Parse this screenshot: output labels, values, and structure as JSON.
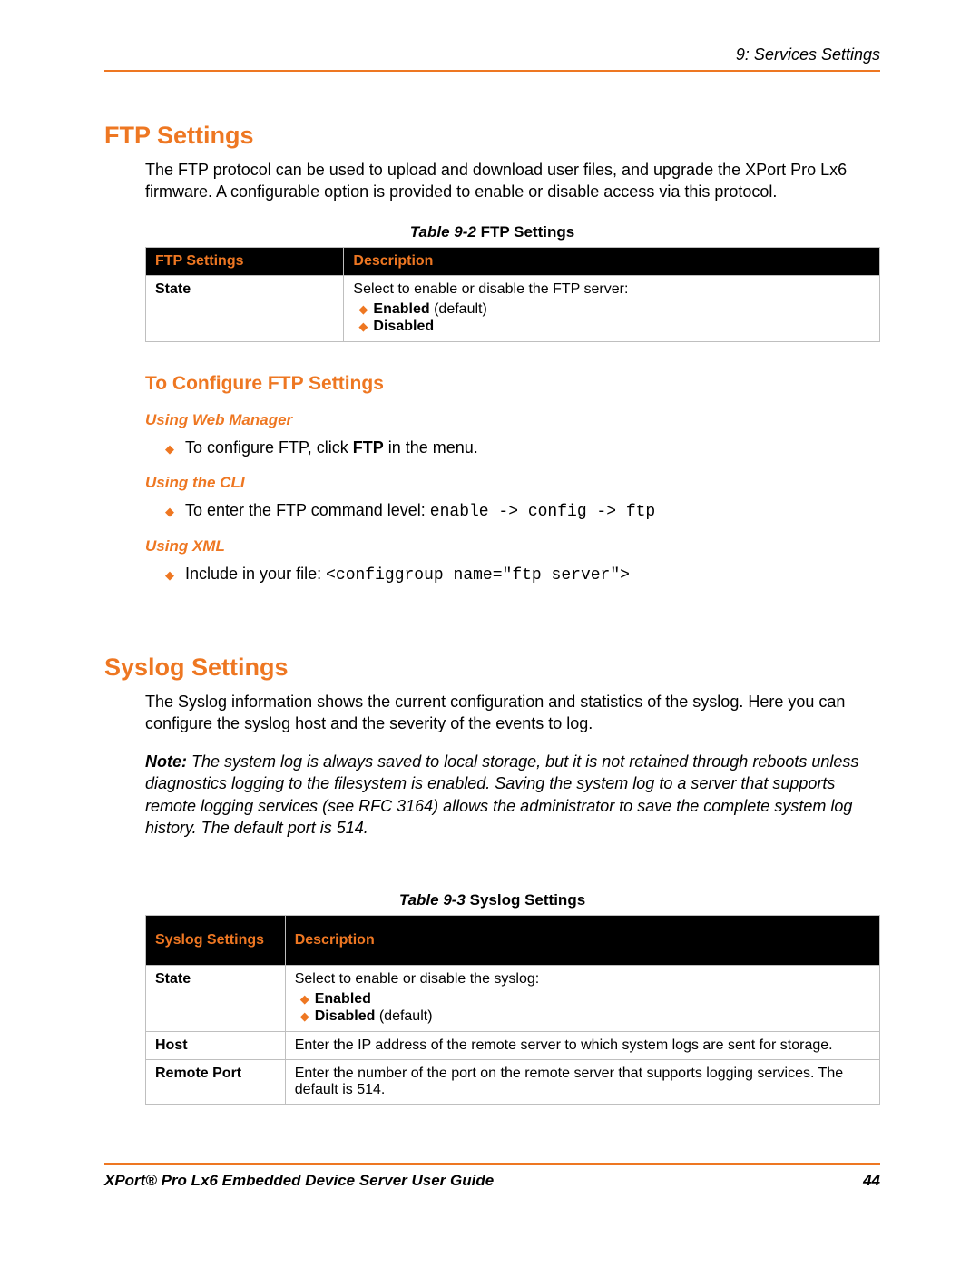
{
  "header": {
    "chapter": "9: Services Settings"
  },
  "ftp": {
    "heading": "FTP Settings",
    "intro": "The FTP protocol can be used to upload and download user files, and upgrade the XPort Pro Lx6 firmware.  A configurable option is provided to enable or disable access via this protocol.",
    "table_caption_num": "Table 9-2",
    "table_caption_title": "  FTP Settings",
    "th1": "FTP Settings",
    "th2": "Description",
    "row1_label": "State",
    "row1_desc": "Select to enable or disable the FTP server:",
    "row1_opt1_bold": "Enabled",
    "row1_opt1_rest": " (default)",
    "row1_opt2_bold": "Disabled",
    "configure_heading": "To Configure FTP Settings",
    "m1": "Using Web Manager",
    "m1_line_pre": "To configure FTP, click ",
    "m1_line_bold": "FTP",
    "m1_line_post": " in the menu.",
    "m2": "Using the CLI",
    "m2_line_pre": "To enter the FTP command level: ",
    "m2_code": "enable -> config -> ftp",
    "m3": "Using XML",
    "m3_line_pre": "Include in your file:   ",
    "m3_code": "<configgroup name=\"ftp server\">"
  },
  "syslog": {
    "heading": "Syslog Settings",
    "intro": "The Syslog information shows the current configuration and statistics of the syslog. Here you can configure the syslog host and the severity of the events to log.",
    "note_lead": "Note:",
    "note_body": "   The system log is always saved to local storage, but it is not retained through reboots unless diagnostics logging to the filesystem is enabled. Saving the system log to a server that supports remote logging services (see RFC 3164) allows the administrator to save the complete system log history. The default port is 514.",
    "table_caption_num": "Table 9-3",
    "table_caption_title": "  Syslog Settings",
    "th1": "Syslog Settings",
    "th2": "Description",
    "r1_label": "State",
    "r1_desc": "Select to enable or disable the syslog:",
    "r1_opt1_bold": "Enabled",
    "r1_opt2_bold": "Disabled",
    "r1_opt2_rest": " (default)",
    "r2_label": "Host",
    "r2_desc": "Enter the IP address of the remote server to which system logs are sent for storage.",
    "r3_label": "Remote Port",
    "r3_desc": "Enter the number of the port on the remote server that supports logging services. The default is 514."
  },
  "footer": {
    "title": "XPort® Pro Lx6 Embedded Device Server User Guide",
    "page": "44"
  }
}
